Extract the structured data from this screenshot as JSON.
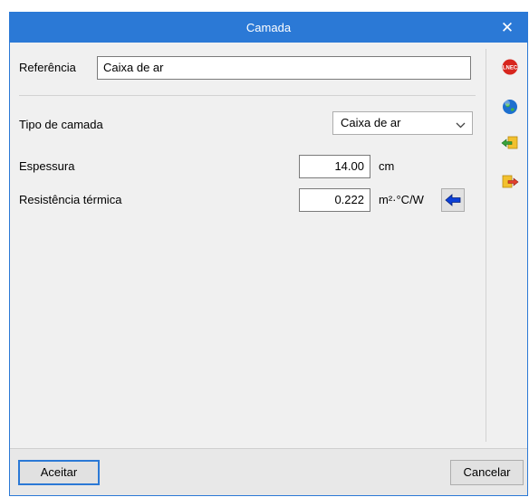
{
  "window": {
    "title": "Camada"
  },
  "form": {
    "referencia_label": "Referência",
    "referencia_value": "Caixa de ar",
    "tipo_label": "Tipo de camada",
    "tipo_value": "Caixa de ar",
    "espessura_label": "Espessura",
    "espessura_value": "14.00",
    "espessura_unit": "cm",
    "resistencia_label": "Resistência térmica",
    "resistencia_value": "0.222",
    "resistencia_unit": "m²·°C/W"
  },
  "side_toolbar": {
    "items": [
      {
        "icon": "lnec-icon",
        "text": "LNEC"
      },
      {
        "icon": "globe-icon"
      },
      {
        "icon": "import-arrow-icon"
      },
      {
        "icon": "export-arrow-icon"
      }
    ]
  },
  "footer": {
    "accept_label": "Aceitar",
    "cancel_label": "Cancelar"
  },
  "colors": {
    "titlebar": "#2b79d6",
    "lnec_badge": "#d7261e",
    "arrow_blue": "#0b3fd6"
  }
}
